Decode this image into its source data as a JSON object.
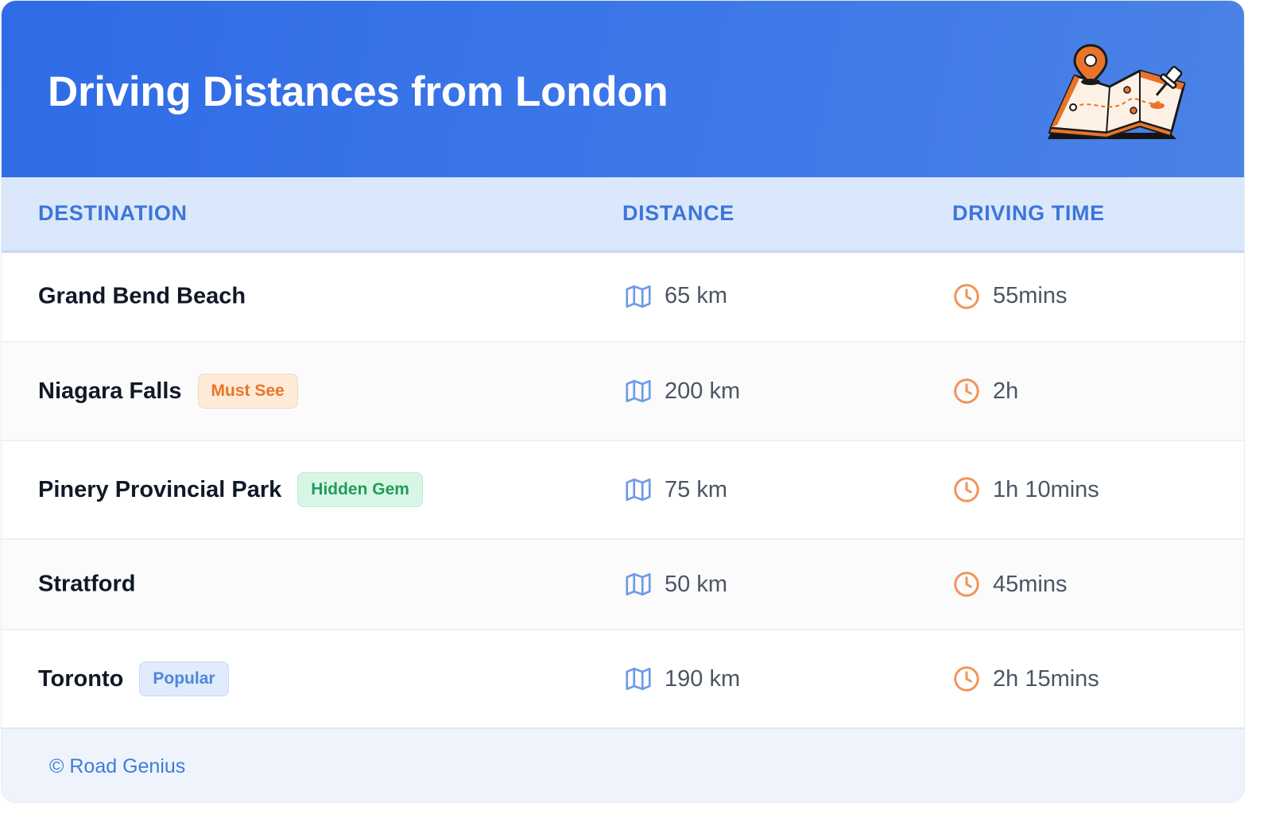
{
  "header": {
    "title": "Driving Distances from London",
    "illustration": "folded-map-with-pins-icon",
    "colors": {
      "gradient_start": "#2f6be6",
      "gradient_end": "#4a82e6"
    }
  },
  "columns": {
    "destination": "DESTINATION",
    "distance": "DISTANCE",
    "driving_time": "DRIVING TIME"
  },
  "rows": [
    {
      "destination": "Grand Bend Beach",
      "badge": "",
      "distance": "65 km",
      "time": "55mins"
    },
    {
      "destination": "Niagara Falls",
      "badge": "Must See",
      "badge_color": "#ec7428",
      "distance": "200 km",
      "time": "2h"
    },
    {
      "destination": "Pinery Provincial Park",
      "badge": "Hidden Gem",
      "badge_color": "#1f9d5a",
      "distance": "75 km",
      "time": "1h 10mins"
    },
    {
      "destination": "Stratford",
      "badge": "",
      "distance": "50 km",
      "time": "45mins"
    },
    {
      "destination": "Toronto",
      "badge": "Popular",
      "badge_color": "#4f86db",
      "distance": "190 km",
      "time": "2h 15mins"
    }
  ],
  "icons": {
    "distance": "map-icon",
    "time": "clock-icon"
  },
  "footer": {
    "text": "© Road Genius"
  },
  "colors": {
    "accent": "#3c76d8",
    "clock_icon": "#f0955a",
    "map_icon": "#6f9be3"
  }
}
